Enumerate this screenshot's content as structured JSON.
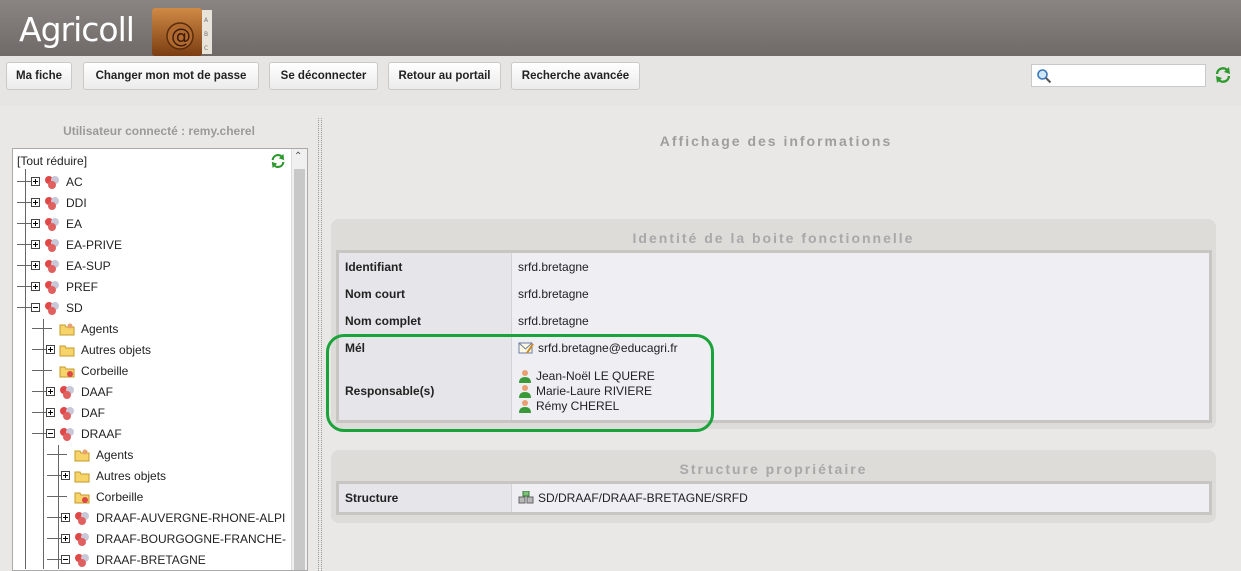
{
  "header": {
    "app_title": "Agricoll",
    "logo_name": "address-book-logo"
  },
  "toolbar": {
    "buttons": [
      "Ma fiche",
      "Changer mon mot de passe",
      "Se déconnecter",
      "Retour au portail",
      "Recherche avancée"
    ],
    "search_value": ""
  },
  "sidebar": {
    "connected_user": "Utilisateur connecté : remy.cherel",
    "collapse_all": "[Tout réduire]",
    "tree": [
      {
        "label": "AC",
        "icon": "directory-icon",
        "expander": "plus"
      },
      {
        "label": "DDI",
        "icon": "directory-icon",
        "expander": "plus"
      },
      {
        "label": "EA",
        "icon": "directory-icon",
        "expander": "plus"
      },
      {
        "label": "EA-PRIVE",
        "icon": "directory-icon",
        "expander": "plus"
      },
      {
        "label": "EA-SUP",
        "icon": "directory-icon",
        "expander": "plus"
      },
      {
        "label": "PREF",
        "icon": "directory-icon",
        "expander": "plus"
      },
      {
        "label": "SD",
        "icon": "directory-icon",
        "expander": "minus"
      },
      {
        "label": "Agents",
        "icon": "agents-folder-icon",
        "expander": ""
      },
      {
        "label": "Autres objets",
        "icon": "folder-icon",
        "expander": "plus"
      },
      {
        "label": "Corbeille",
        "icon": "trash-folder-icon",
        "expander": ""
      },
      {
        "label": "DAAF",
        "icon": "directory-icon",
        "expander": "plus"
      },
      {
        "label": "DAF",
        "icon": "directory-icon",
        "expander": "plus"
      },
      {
        "label": "DRAAF",
        "icon": "directory-icon",
        "expander": "minus"
      },
      {
        "label": "Agents",
        "icon": "agents-folder-icon",
        "expander": ""
      },
      {
        "label": "Autres objets",
        "icon": "folder-icon",
        "expander": "plus"
      },
      {
        "label": "Corbeille",
        "icon": "trash-folder-icon",
        "expander": ""
      },
      {
        "label": "DRAAF-AUVERGNE-RHONE-ALPI",
        "icon": "directory-icon",
        "expander": "plus"
      },
      {
        "label": "DRAAF-BOURGOGNE-FRANCHE-",
        "icon": "directory-icon",
        "expander": "plus"
      },
      {
        "label": "DRAAF-BRETAGNE",
        "icon": "directory-icon",
        "expander": "minus"
      }
    ]
  },
  "main": {
    "title": "Affichage des informations",
    "identity": {
      "title": "Identité de la boite fonctionnelle",
      "rows": [
        {
          "label": "Identifiant",
          "value": "srfd.bretagne"
        },
        {
          "label": "Nom court",
          "value": "srfd.bretagne"
        },
        {
          "label": "Nom complet",
          "value": "srfd.bretagne"
        }
      ],
      "mel_label": "Mél",
      "mel_value": "srfd.bretagne@educagri.fr",
      "resp_label": "Responsable(s)",
      "responsables": [
        "Jean-Noël LE QUERE",
        "Marie-Laure RIVIERE",
        "Rémy CHEREL"
      ]
    },
    "structure": {
      "title": "Structure propriétaire",
      "label": "Structure",
      "value": "SD/DRAAF/DRAAF-BRETAGNE/SRFD"
    }
  },
  "colors": {
    "highlight": "#1aa33a",
    "header": "#7a7573"
  }
}
